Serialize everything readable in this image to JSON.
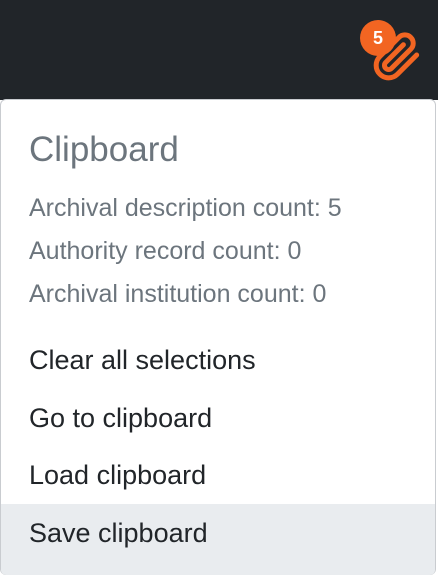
{
  "header": {
    "clipboard_badge_count": "5",
    "clipboard_icon": "paperclip-icon"
  },
  "menu": {
    "title": "Clipboard",
    "counts": [
      "Archival description count: 5",
      "Authority record count: 0",
      "Archival institution count: 0"
    ],
    "items": [
      "Clear all selections",
      "Go to clipboard",
      "Load clipboard",
      "Save clipboard"
    ]
  },
  "colors": {
    "topbar": "#212529",
    "accent": "#f26522",
    "muted_text": "#6c757d",
    "hover_bg": "#e9ecef"
  }
}
